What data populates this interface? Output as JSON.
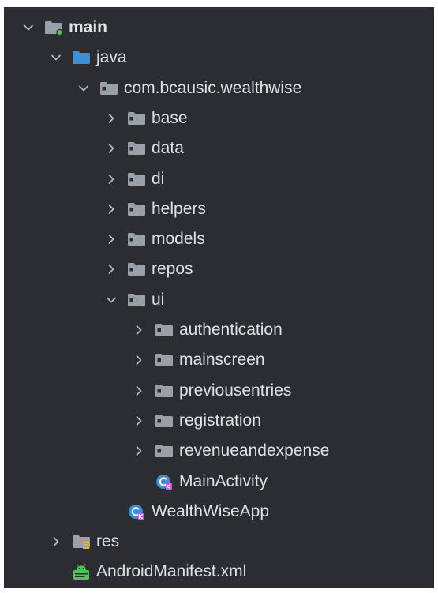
{
  "project_tree": {
    "colors": {
      "background": "#2b2d30",
      "text": "#dfe1e5",
      "chevron": "#b4b8bf",
      "folder_plain": "#9aa0a8",
      "folder_source": "#3d8fd6",
      "folder_module": "#9aa0a8",
      "module_badge": "#4fc35a",
      "kotlin_class": "#3f8fd0",
      "kotlin_badge": "#c857e6",
      "res_badge": "#f0b429",
      "manifest": "#4fc35a"
    },
    "rows": [
      {
        "label": "main",
        "icon": "module-folder-icon",
        "chevron": "expanded",
        "depth": 0,
        "bold": true
      },
      {
        "label": "java",
        "icon": "source-folder-icon",
        "chevron": "expanded",
        "depth": 1
      },
      {
        "label": "com.bcausic.wealthwise",
        "icon": "package-folder-icon",
        "chevron": "expanded",
        "depth": 2
      },
      {
        "label": "base",
        "icon": "package-folder-icon",
        "chevron": "collapsed",
        "depth": 3
      },
      {
        "label": "data",
        "icon": "package-folder-icon",
        "chevron": "collapsed",
        "depth": 3
      },
      {
        "label": "di",
        "icon": "package-folder-icon",
        "chevron": "collapsed",
        "depth": 3
      },
      {
        "label": "helpers",
        "icon": "package-folder-icon",
        "chevron": "collapsed",
        "depth": 3
      },
      {
        "label": "models",
        "icon": "package-folder-icon",
        "chevron": "collapsed",
        "depth": 3
      },
      {
        "label": "repos",
        "icon": "package-folder-icon",
        "chevron": "collapsed",
        "depth": 3
      },
      {
        "label": "ui",
        "icon": "package-folder-icon",
        "chevron": "expanded",
        "depth": 3
      },
      {
        "label": "authentication",
        "icon": "package-folder-icon",
        "chevron": "collapsed",
        "depth": 4
      },
      {
        "label": "mainscreen",
        "icon": "package-folder-icon",
        "chevron": "collapsed",
        "depth": 4
      },
      {
        "label": "previousentries",
        "icon": "package-folder-icon",
        "chevron": "collapsed",
        "depth": 4
      },
      {
        "label": "registration",
        "icon": "package-folder-icon",
        "chevron": "collapsed",
        "depth": 4
      },
      {
        "label": "revenueandexpense",
        "icon": "package-folder-icon",
        "chevron": "collapsed",
        "depth": 4
      },
      {
        "label": "MainActivity",
        "icon": "kotlin-class-icon",
        "chevron": "none",
        "depth": 4
      },
      {
        "label": "WealthWiseApp",
        "icon": "kotlin-class-icon",
        "chevron": "none",
        "depth": 3
      },
      {
        "label": "res",
        "icon": "resources-folder-icon",
        "chevron": "collapsed",
        "depth": 1
      },
      {
        "label": "AndroidManifest.xml",
        "icon": "android-manifest-icon",
        "chevron": "none",
        "depth": 1
      }
    ]
  }
}
